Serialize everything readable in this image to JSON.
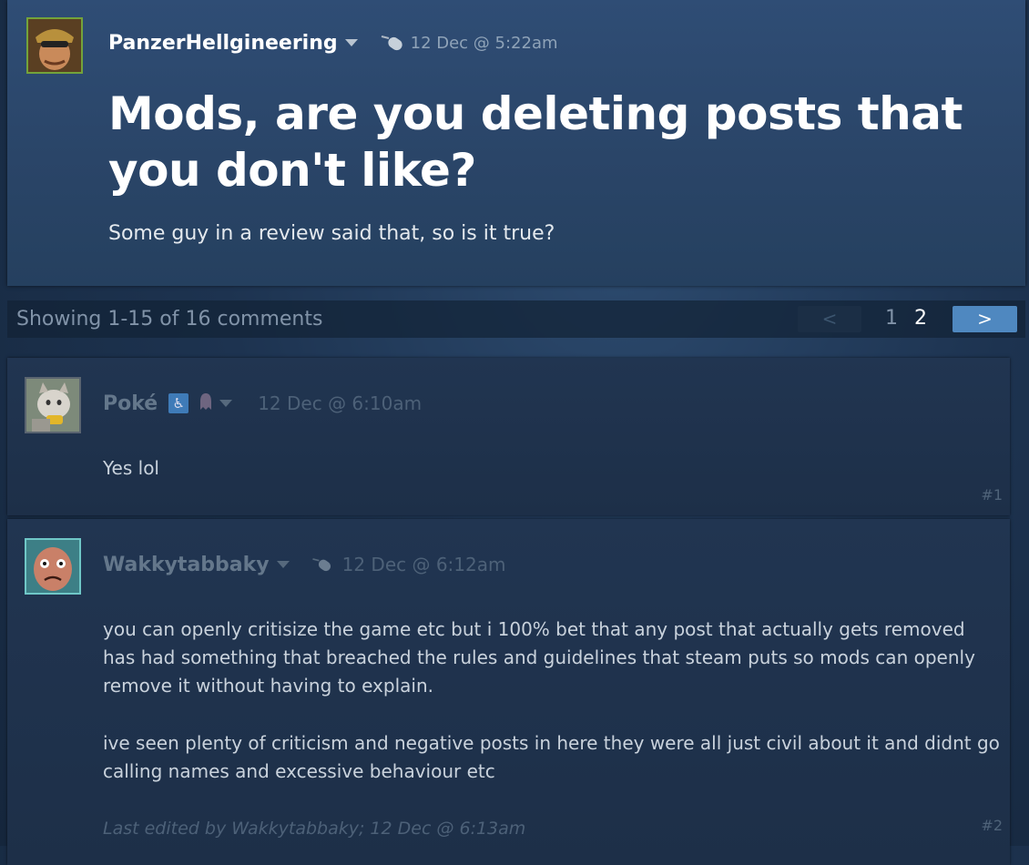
{
  "topic": {
    "author": "PanzerHellgineering",
    "date": "12 Dec @ 5:22am",
    "title": "Mods, are you deleting posts that you don't like?",
    "body": "Some guy in a review said that, so is it true?"
  },
  "paging": {
    "summary": "Showing 1-15 of 16 comments",
    "prev": "<",
    "pages": [
      "1",
      "2"
    ],
    "next": ">"
  },
  "comments": [
    {
      "author": "Poké",
      "date": "12 Dec @ 6:10am",
      "text": "Yes lol",
      "number": "#1"
    },
    {
      "author": "Wakkytabbaky",
      "date": "12 Dec @ 6:12am",
      "paragraphs": [
        "you can openly critisize the game etc but i 100% bet that any post that actually gets removed has had something that breached the rules and guidelines that steam puts so mods can openly remove it without having to explain.",
        "ive seen plenty of criticism and negative posts in here they were all just civil about it and didnt go calling names and excessive behaviour etc"
      ],
      "edited": "Last edited by Wakkytabbaky; 12 Dec @ 6:13am",
      "number": "#2"
    }
  ]
}
